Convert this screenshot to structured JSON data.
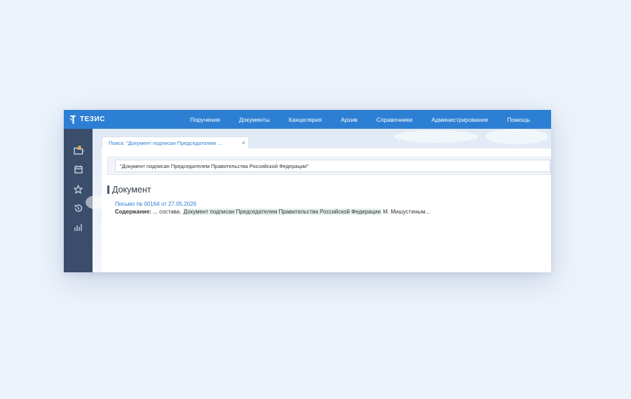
{
  "app": {
    "logo_text": "ТЕЗИС"
  },
  "nav": {
    "items": [
      {
        "label": "Поручения"
      },
      {
        "label": "Документы"
      },
      {
        "label": "Канцелярия"
      },
      {
        "label": "Архив"
      },
      {
        "label": "Справочники"
      },
      {
        "label": "Администрирование"
      },
      {
        "label": "Помощь"
      }
    ]
  },
  "sidebar": {
    "icons": [
      "folder-icon",
      "calendar-icon",
      "star-icon",
      "history-icon",
      "chart-icon"
    ]
  },
  "tab": {
    "label": "Поиск: \"Документ подписан Председателем ...",
    "close": "×"
  },
  "search": {
    "value": "\"Документ подписан Председателем Правительства Российской Федерации\""
  },
  "section": {
    "title": "Документ"
  },
  "result": {
    "link": "Письмо № 00164 от 27.05.2026",
    "content_label": "Содержание:",
    "content_prefix": "... состава.",
    "content_highlight": "Документ подписан Председателем Правительства Российской Федерации",
    "content_suffix": "М. Мишустиным..."
  },
  "colors": {
    "accent": "#2d7fd3",
    "sidebar": "#3a4d6b",
    "badge": "#f0a340",
    "highlight": "#e3f2ea"
  }
}
